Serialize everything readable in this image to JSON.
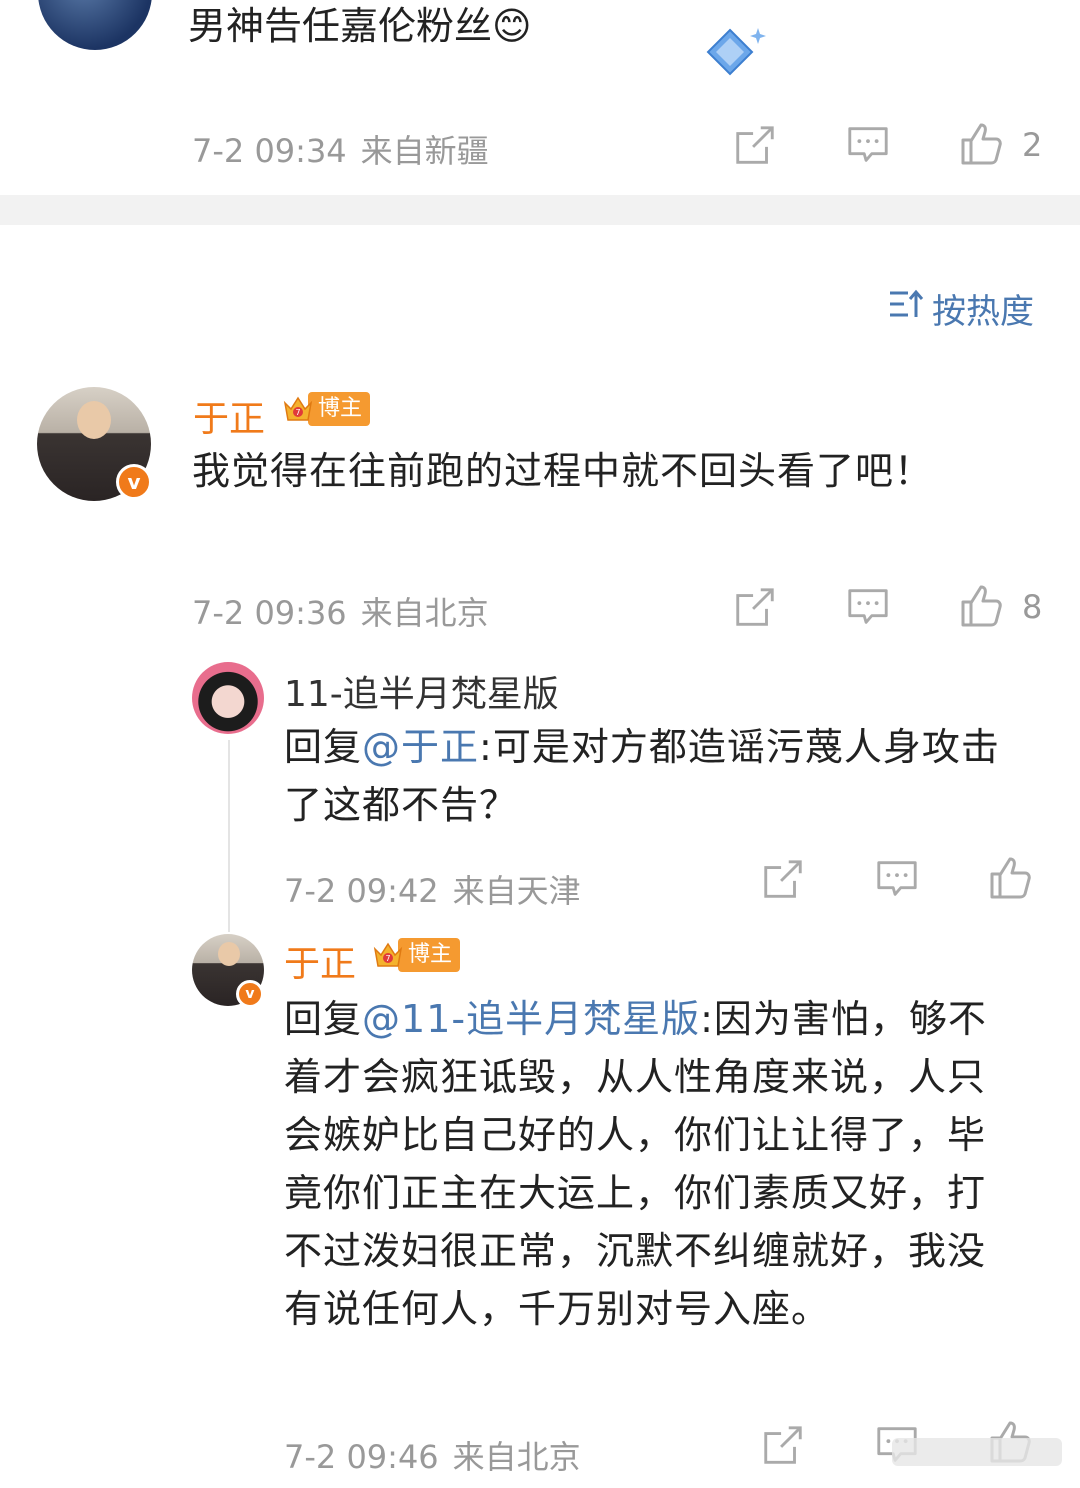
{
  "top_comment": {
    "text": "男神告任嘉伦粉丝😊",
    "time": "7-2 09:34",
    "location": "来自新疆",
    "likes": "2"
  },
  "sort_label": "按热度",
  "comments": [
    {
      "author": "于正",
      "badge": "博主",
      "text": "我觉得在往前跑的过程中就不回头看了吧！",
      "time": "7-2 09:36",
      "location": "来自北京",
      "likes": "8"
    }
  ],
  "replies": [
    {
      "author": "11-追半月梵星版",
      "reply_prefix": "回复",
      "mention": "@于正",
      "text": ":可是对方都造谣污蔑人身攻击了这都不告？",
      "time": "7-2 09:42",
      "location": "来自天津"
    },
    {
      "author": "于正",
      "badge": "博主",
      "reply_prefix": "回复",
      "mention": "@11-追半月梵星版",
      "text": ":因为害怕，够不着才会疯狂诋毁，从人性角度来说，人只会嫉妒比自己好的人，你们让让得了，毕竟你们正主在大运上，你们素质又好，打不过泼妇很正常，沉默不纠缠就好，我没有说任何人，千万别对号入座。",
      "time": "7-2 09:46",
      "location": "来自北京"
    }
  ],
  "icons": {
    "share": "share-icon",
    "comment": "comment-icon",
    "like": "like-icon",
    "sort": "sort-icon",
    "verified": "verified-v-icon",
    "crown": "crown-icon"
  },
  "colors": {
    "accent_blue": "#4a78b0",
    "name_orange": "#f07a1a",
    "meta_gray": "#999999"
  }
}
